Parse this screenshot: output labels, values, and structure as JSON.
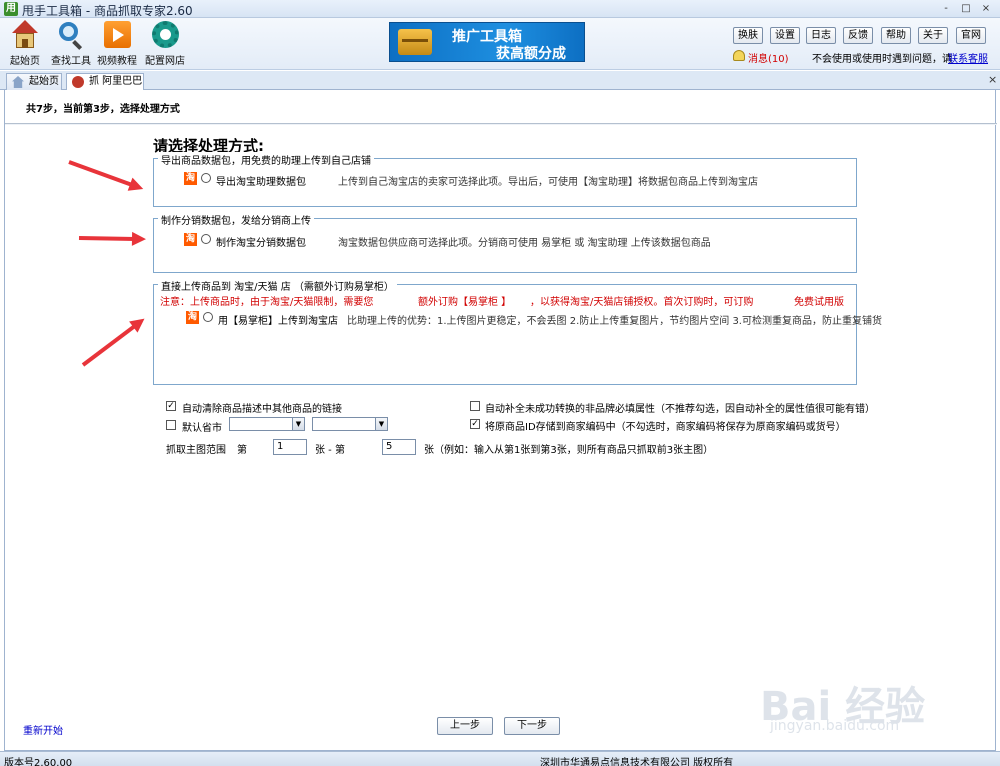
{
  "window": {
    "app_icon": "用",
    "title": "甩手工具箱 - 商品抓取专家2.60",
    "controls": [
      "-",
      "□",
      "×"
    ]
  },
  "toolbar": {
    "tools": [
      {
        "label": "起始页",
        "icon": "home-icon"
      },
      {
        "label": "查找工具",
        "icon": "search-icon"
      },
      {
        "label": "视频教程",
        "icon": "play-icon"
      },
      {
        "label": "配置网店",
        "icon": "gear-icon"
      }
    ],
    "banner": {
      "line1": "推广工具箱",
      "line2": "获高额分成"
    },
    "buttons": [
      "换肤",
      "设置",
      "日志",
      "反馈",
      "帮助",
      "关于",
      "官网"
    ],
    "message": "消息(10)",
    "help_text": "不会使用或使用时遇到问题，请",
    "help_link": "联系客服"
  },
  "tabs": [
    {
      "label": "起始页",
      "icon": "home-icon",
      "active": false
    },
    {
      "label": "抓 阿里巴巴",
      "icon": "alibaba-icon",
      "active": true
    }
  ],
  "content": {
    "step_title": "共7步，当前第3步，选择处理方式",
    "heading": "请选择处理方式:",
    "groups": [
      {
        "legend": "导出商品数据包，用免费的助理上传到自己店铺",
        "option_label": "导出淘宝助理数据包",
        "description": "上传到自己淘宝店的卖家可选择此项。导出后，可使用【淘宝助理】将数据包商品上传到淘宝店",
        "icon": "淘"
      },
      {
        "legend": "制作分销数据包，发给分销商上传",
        "option_label": "制作淘宝分销数据包",
        "description": "淘宝数据包供应商可选择此项。分销商可使用 易掌柜 或 淘宝助理 上传该数据包商品",
        "icon": "淘"
      },
      {
        "legend": "直接上传商品到 淘宝/天猫 店 （需额外订购易掌柜）",
        "notice": "注意：上传商品时，由于淘宝/天猫限制，需要您",
        "notice_red": "额外订购【易掌柜 】",
        "notice_rest": "，以获得淘宝/天猫店铺授权。首次订购时，可订购",
        "notice_trial": "免费试用版",
        "option_label": "用【易掌柜】上传到淘宝店",
        "description": "比助理上传的优势：1.上传图片更稳定，不会丢图 2.防止上传重复图片，节约图片空间 3.可检测重复商品，防止重复铺货",
        "icon": "淘"
      }
    ],
    "options": {
      "auto_clear_links": {
        "label": "自动清除商品描述中其他商品的链接",
        "checked": true
      },
      "auto_fill_brand": {
        "label": "自动补全未成功转换的非品牌必填属性（不推荐勾选，因自动补全的属性值很可能有错）",
        "checked": false
      },
      "default_province": {
        "label": "默认省市",
        "checked": false
      },
      "save_item_id": {
        "label": "将原商品ID存储到商家编码中（不勾选时，商家编码将保存为原商家编码或货号）",
        "checked": true
      }
    },
    "image_range": {
      "label": "抓取主图范围",
      "from_prefix": "第",
      "from_value": "1",
      "from_unit": "张 - 第",
      "to_value": "5",
      "to_unit": "张（例如：输入从第1张到第3张，则所有商品只抓取前3张主图）"
    },
    "restart_link": "重新开始",
    "prev_button": "上一步",
    "next_button": "下一步"
  },
  "watermark": {
    "logo": "Bai 经验",
    "url": "jingyan.baidu.com"
  },
  "status": {
    "version": "版本号2.60.00",
    "company": "深圳市华通易点信息技术有限公司  版权所有"
  },
  "colors": {
    "accent_red": "#d10000",
    "link_blue": "#0000cc",
    "group_border": "#7fa7cc",
    "taobao_orange": "#ff5a00"
  }
}
